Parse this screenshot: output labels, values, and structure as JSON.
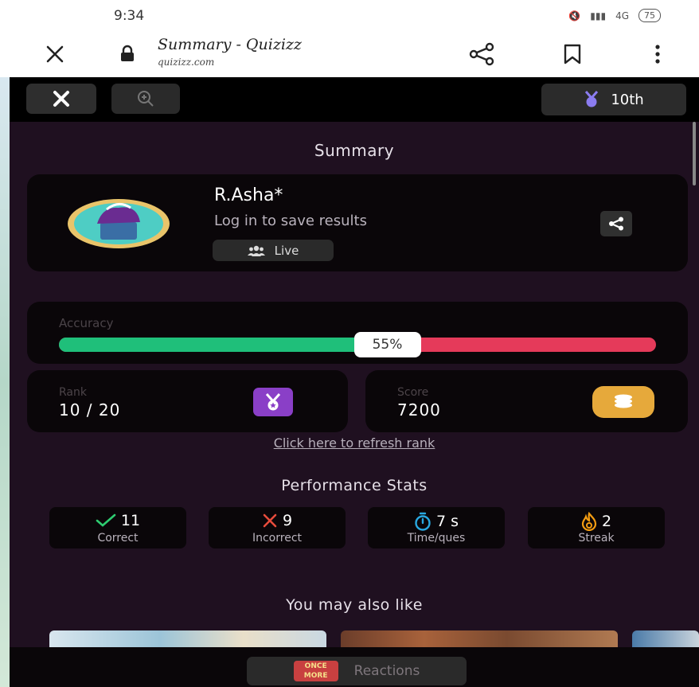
{
  "status_bar": {
    "time": "9:34",
    "network": "4G",
    "battery": "75"
  },
  "browser": {
    "page_title": "Summary - Quizizz",
    "url": "quizizz.com",
    "icons": [
      "close-icon",
      "lock-icon",
      "share-icon",
      "bookmark-icon",
      "more-vert-icon"
    ]
  },
  "topbar": {
    "rank_text": "10th",
    "icons": [
      "close-icon",
      "zoom-in-icon",
      "medal-icon"
    ]
  },
  "summary": {
    "heading": "Summary",
    "player_name": "R.Asha*",
    "login_text": "Log in to save results",
    "mode_label": "Live"
  },
  "accuracy": {
    "label": "Accuracy",
    "percent": 55,
    "display": "55%",
    "correct_color": "#1fbf7a",
    "incorrect_color": "#e53a5a"
  },
  "rank": {
    "label": "Rank",
    "value": "10 / 20",
    "icon": "medal-icon",
    "icon_color": "#8a3fc7"
  },
  "score": {
    "label": "Score",
    "value": "7200",
    "icon": "coins-icon",
    "icon_color": "#e6a93b"
  },
  "refresh_link": "Click here to refresh rank",
  "performance": {
    "heading": "Performance Stats",
    "stats": [
      {
        "value": "11",
        "label": "Correct",
        "icon": "check-icon",
        "color": "#2ecc71"
      },
      {
        "value": "9",
        "label": "Incorrect",
        "icon": "cross-icon",
        "color": "#e74c3c"
      },
      {
        "value": "7 s",
        "label": "Time/ques",
        "icon": "stopwatch-icon",
        "color": "#29a8e0"
      },
      {
        "value": "2",
        "label": "Streak",
        "icon": "flame-icon",
        "color": "#f39c12"
      }
    ]
  },
  "recommendations": {
    "heading": "You may also like"
  },
  "reactions": {
    "label": "Reactions",
    "logo_text": "ONCE MORE"
  }
}
